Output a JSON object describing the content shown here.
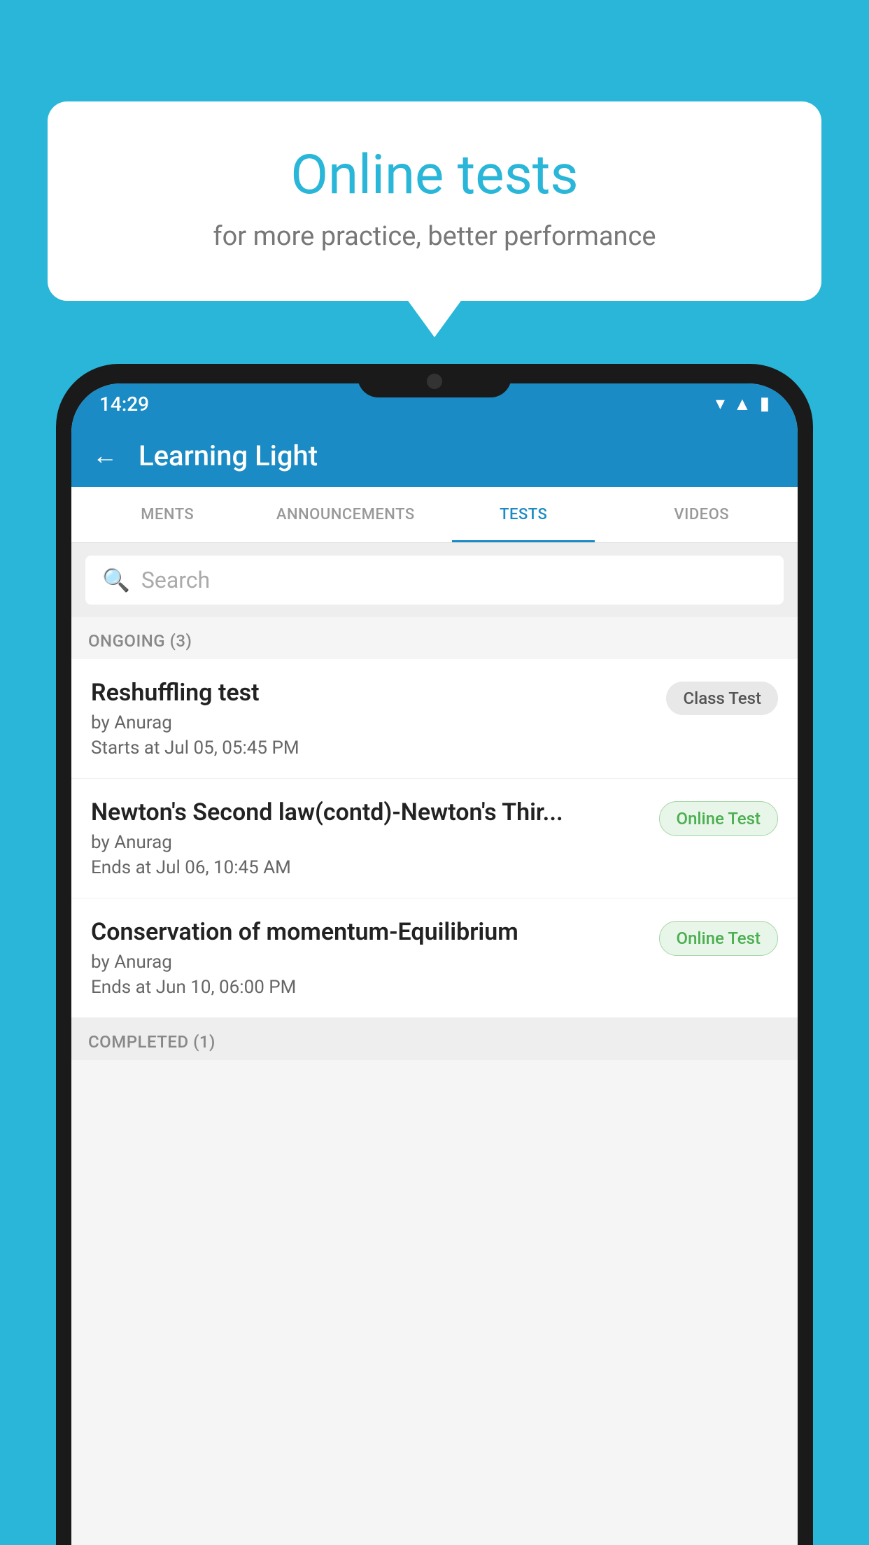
{
  "background_color": "#29b6d8",
  "bubble": {
    "title": "Online tests",
    "subtitle": "for more practice, better performance"
  },
  "phone": {
    "status_bar": {
      "time": "14:29",
      "icons": [
        "wifi",
        "signal",
        "battery"
      ]
    },
    "header": {
      "title": "Learning Light",
      "back_label": "←"
    },
    "tabs": [
      {
        "label": "MENTS",
        "active": false
      },
      {
        "label": "ANNOUNCEMENTS",
        "active": false
      },
      {
        "label": "TESTS",
        "active": true
      },
      {
        "label": "VIDEOS",
        "active": false
      }
    ],
    "search": {
      "placeholder": "Search"
    },
    "sections": [
      {
        "label": "ONGOING (3)",
        "items": [
          {
            "name": "Reshuffling test",
            "author": "by Anurag",
            "date_label": "Starts at",
            "date": "Jul 05, 05:45 PM",
            "badge": "Class Test",
            "badge_type": "class"
          },
          {
            "name": "Newton's Second law(contd)-Newton's Thir...",
            "author": "by Anurag",
            "date_label": "Ends at",
            "date": "Jul 06, 10:45 AM",
            "badge": "Online Test",
            "badge_type": "online"
          },
          {
            "name": "Conservation of momentum-Equilibrium",
            "author": "by Anurag",
            "date_label": "Ends at",
            "date": "Jun 10, 06:00 PM",
            "badge": "Online Test",
            "badge_type": "online"
          }
        ]
      }
    ],
    "completed_label": "COMPLETED (1)"
  }
}
